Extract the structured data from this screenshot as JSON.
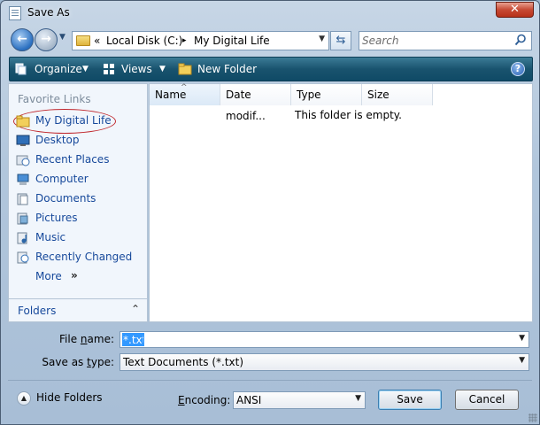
{
  "window": {
    "title": "Save As",
    "close_label": "✕"
  },
  "address": {
    "prefix": "«",
    "crumbs": [
      "Local Disk (C:)",
      "My Digital Life"
    ],
    "separator": "▸",
    "refresh_icon": "refresh-icon"
  },
  "search": {
    "placeholder": "Search"
  },
  "toolbar": {
    "organize_label": "Organize",
    "views_label": "Views",
    "new_folder_label": "New Folder",
    "help_label": "?"
  },
  "nav_pane": {
    "heading": "Favorite Links",
    "links": [
      {
        "label": "My Digital Life",
        "icon": "folder-icon"
      },
      {
        "label": "Desktop",
        "icon": "desktop-icon"
      },
      {
        "label": "Recent Places",
        "icon": "recent-places-icon"
      },
      {
        "label": "Computer",
        "icon": "computer-icon"
      },
      {
        "label": "Documents",
        "icon": "documents-icon"
      },
      {
        "label": "Pictures",
        "icon": "pictures-icon"
      },
      {
        "label": "Music",
        "icon": "music-icon"
      },
      {
        "label": "Recently Changed",
        "icon": "recently-changed-icon"
      },
      {
        "label": "More",
        "icon": "more-chevron-icon"
      }
    ],
    "folders_label": "Folders"
  },
  "file_list": {
    "columns": [
      "Name",
      "Date modif...",
      "Type",
      "Size"
    ],
    "empty_message": "This folder is empty."
  },
  "form": {
    "filename_label_pre": "File ",
    "filename_label_acc": "n",
    "filename_label_post": "ame:",
    "filename_value": "*.txt",
    "savetype_label_pre": "Save as ",
    "savetype_label_acc": "t",
    "savetype_label_post": "ype:",
    "savetype_value": "Text Documents (*.txt)",
    "encoding_label_pre": "",
    "encoding_label_acc": "E",
    "encoding_label_post": "ncoding:",
    "encoding_value": "ANSI"
  },
  "footer": {
    "hide_folders_label": "Hide Folders",
    "save_label": "Save",
    "cancel_label": "Cancel"
  },
  "colors": {
    "accent_link": "#17499b",
    "command_bar": "#19536e",
    "highlight_ring": "#c0272d",
    "selection": "#3399ff"
  }
}
